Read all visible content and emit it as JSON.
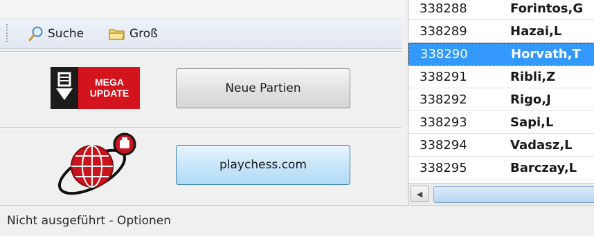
{
  "toolbar": {
    "search_label": "Suche",
    "large_label": "Groß"
  },
  "actions": {
    "mega_update_line1": "MEGA",
    "mega_update_line2": "UPDATE",
    "neue_partien_label": "Neue Partien",
    "playchess_label": "playchess.com"
  },
  "players": [
    {
      "id": "338288",
      "name": "Forintos,G"
    },
    {
      "id": "338289",
      "name": "Hazai,L"
    },
    {
      "id": "338290",
      "name": "Horvath,T",
      "selected": true
    },
    {
      "id": "338291",
      "name": "Ribli,Z"
    },
    {
      "id": "338292",
      "name": "Rigo,J"
    },
    {
      "id": "338293",
      "name": "Sapi,L"
    },
    {
      "id": "338294",
      "name": "Vadasz,L"
    },
    {
      "id": "338295",
      "name": "Barczay,L"
    }
  ],
  "status": {
    "text": "Nicht ausgeführt - Optionen"
  },
  "colors": {
    "selection": "#3399ff",
    "mega_red": "#d4141c",
    "playchess_button": "#b0dbf7"
  }
}
